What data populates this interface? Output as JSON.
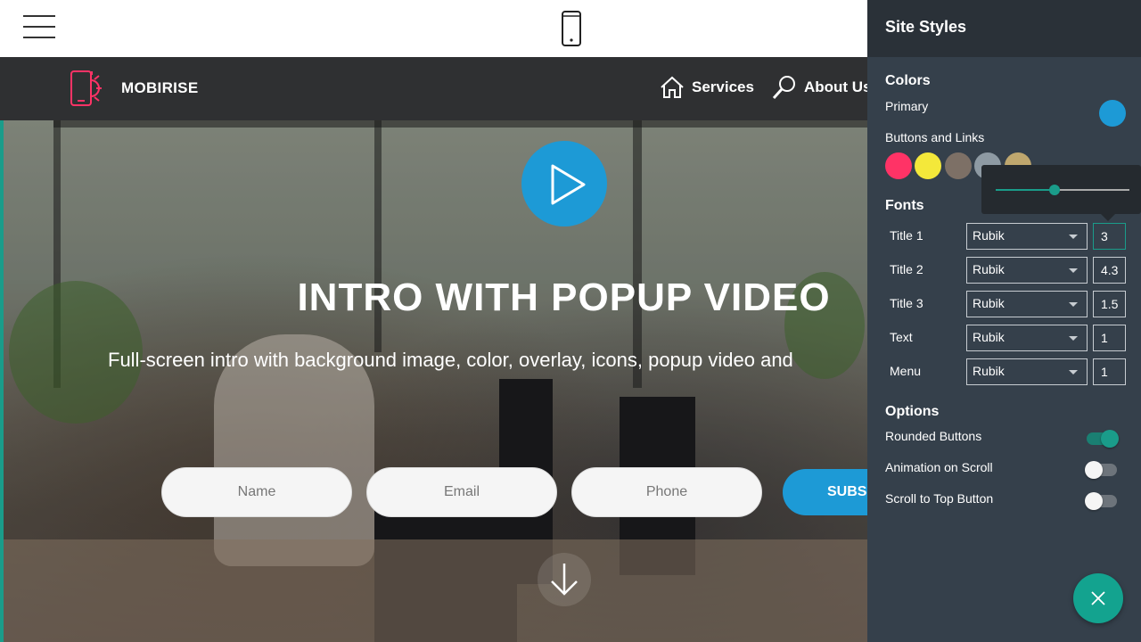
{
  "topbar": {
    "menu_icon": "hamburger-icon",
    "device_icon": "mobile-phone-icon"
  },
  "site": {
    "brand": "MOBIRISE",
    "nav": [
      {
        "label": "Services",
        "icon": "home-icon"
      },
      {
        "label": "About Us",
        "icon": "search-icon"
      }
    ]
  },
  "hero": {
    "title": "INTRO WITH POPUP VIDEO",
    "subtitle": "Full-screen intro with background image, color, overlay, icons, popup video and",
    "form": {
      "name_placeholder": "Name",
      "email_placeholder": "Email",
      "phone_placeholder": "Phone",
      "submit_label": "SUBS"
    }
  },
  "panel": {
    "title": "Site Styles",
    "colors_heading": "Colors",
    "primary_label": "Primary",
    "primary_color": "#1d9ad6",
    "buttons_links_label": "Buttons and Links",
    "swatches": [
      "#ff3366",
      "#f4e83a",
      "#7d7066",
      "#8e9aa3",
      "#bfa76e"
    ],
    "slider_value": 0.44,
    "fonts_heading": "Fonts",
    "fonts": [
      {
        "label": "Title 1",
        "font": "Rubik",
        "size": "3"
      },
      {
        "label": "Title 2",
        "font": "Rubik",
        "size": "4.3"
      },
      {
        "label": "Title 3",
        "font": "Rubik",
        "size": "1.5"
      },
      {
        "label": "Text",
        "font": "Rubik",
        "size": "1"
      },
      {
        "label": "Menu",
        "font": "Rubik",
        "size": "1"
      }
    ],
    "options_heading": "Options",
    "options": [
      {
        "label": "Rounded Buttons",
        "on": true
      },
      {
        "label": "Animation on Scroll",
        "on": false
      },
      {
        "label": "Scroll to Top Button",
        "on": false
      }
    ],
    "close_icon": "close-icon"
  }
}
